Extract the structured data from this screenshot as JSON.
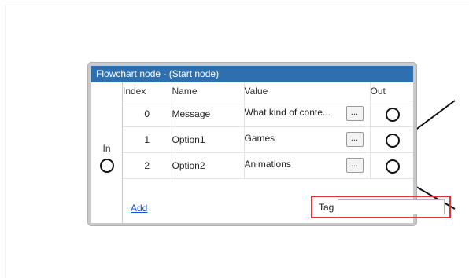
{
  "node": {
    "title": "Flowchart node - (Start node)",
    "in_label": "In",
    "columns": [
      "Index",
      "Name",
      "Value",
      "Out"
    ],
    "rows": [
      {
        "index": "0",
        "name": "Message",
        "value": "What kind of conte...",
        "button": "..."
      },
      {
        "index": "1",
        "name": "Option1",
        "value": "Games",
        "button": "..."
      },
      {
        "index": "2",
        "name": "Option2",
        "value": "Animations",
        "button": "..."
      }
    ],
    "add_label": "Add",
    "tag_label": "Tag",
    "tag_value": ""
  },
  "colors": {
    "title_bar": "#2e6fb0",
    "highlight": "#e2333b",
    "link": "#1a4fd6"
  }
}
